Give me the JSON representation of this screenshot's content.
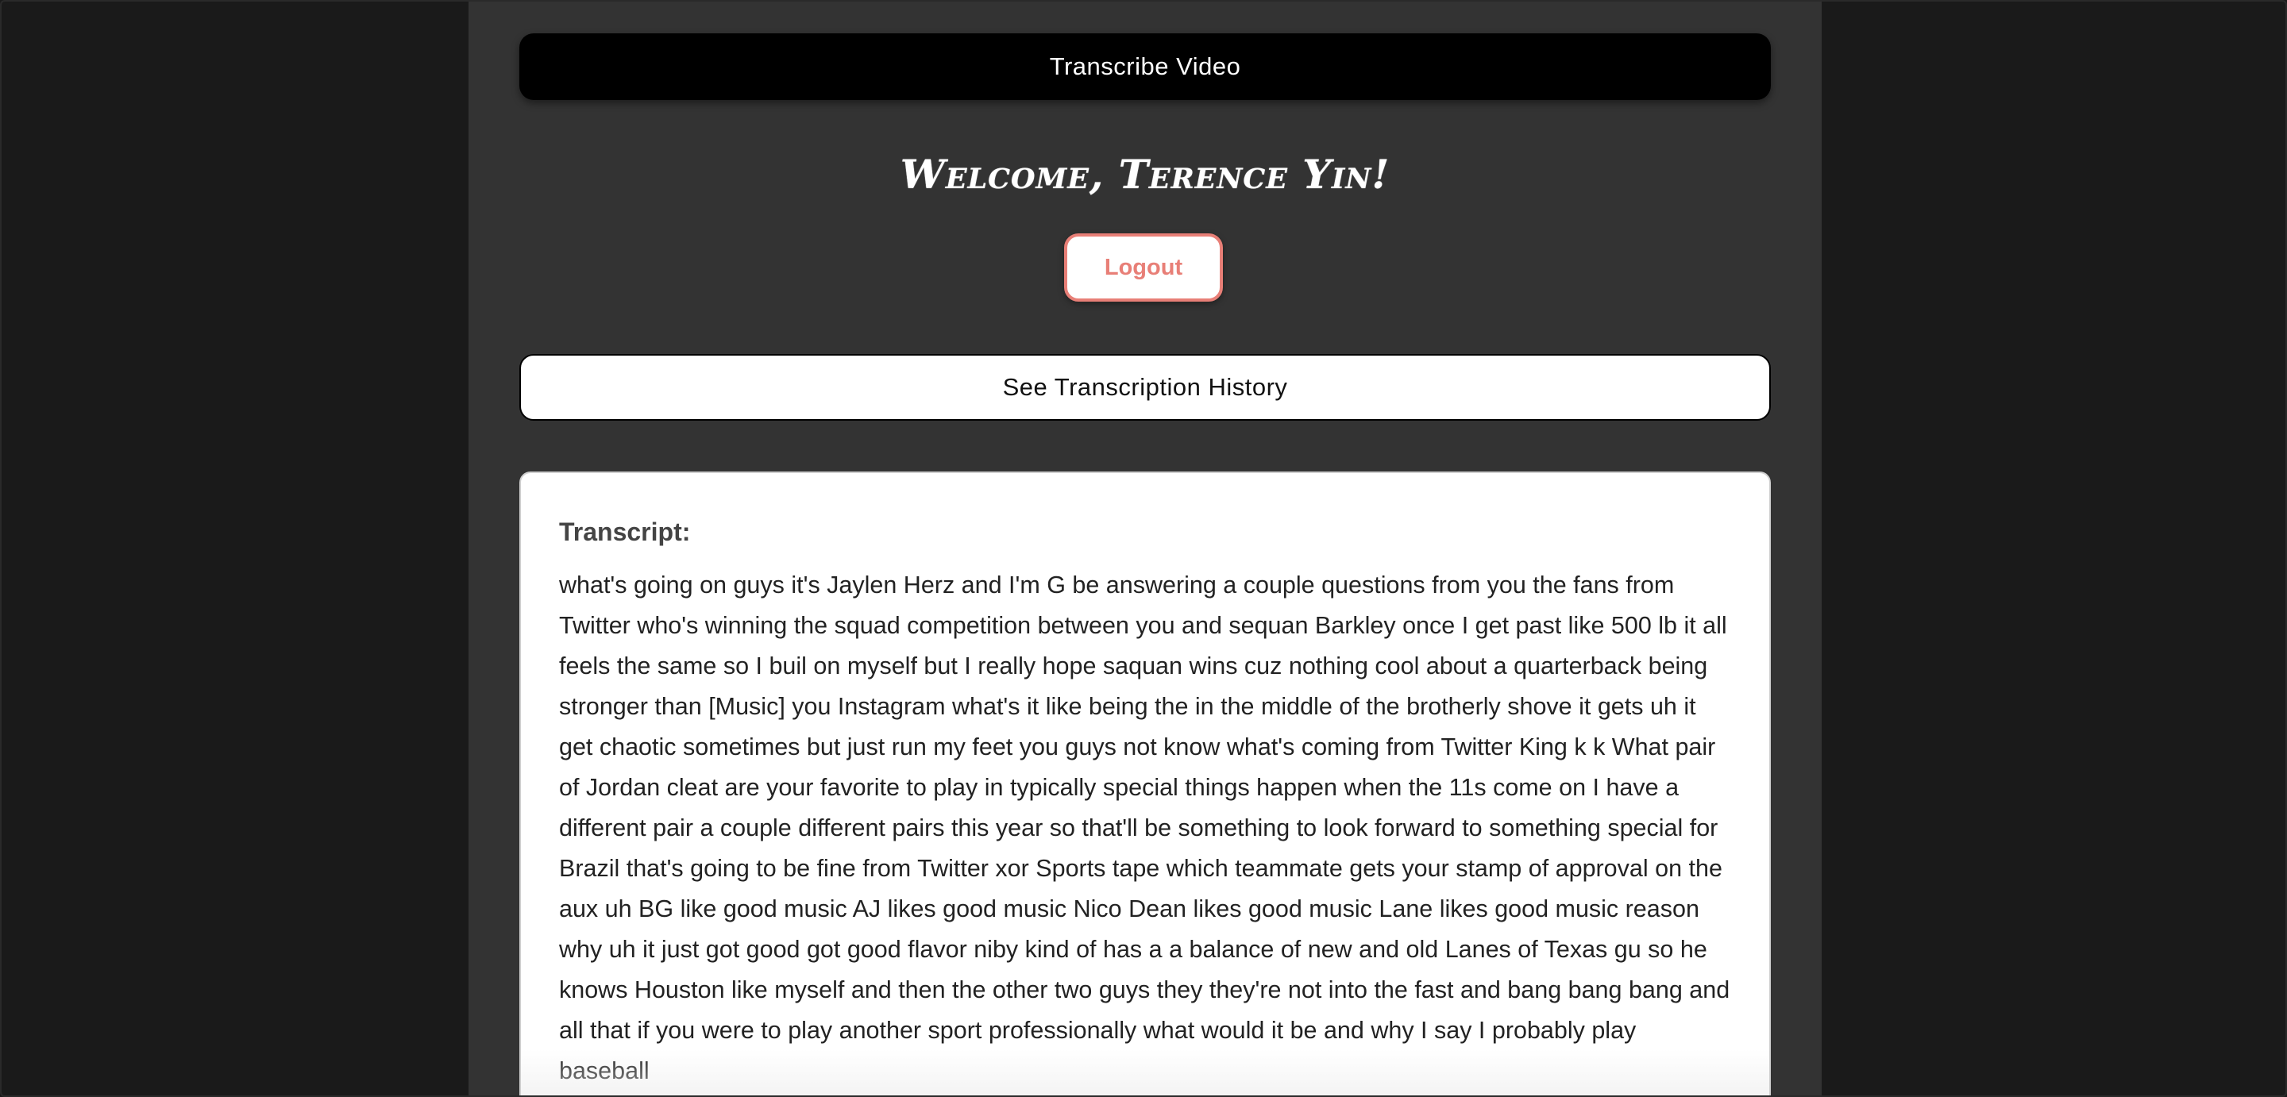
{
  "actions": {
    "transcribe_label": "Transcribe Video",
    "logout_label": "Logout",
    "history_label": "See Transcription History"
  },
  "header": {
    "welcome": "Welcome, Terence Yin!"
  },
  "transcript": {
    "heading": "Transcript:",
    "text": "what's going on guys it's Jaylen Herz and I'm G be answering a couple questions from you the fans from Twitter who's winning the squad competition between you and sequan Barkley once I get past like 500 lb it all feels the same so I buil on myself but I really hope saquan wins cuz nothing cool about a quarterback being stronger than [Music] you Instagram what's it like being the in the middle of the brotherly shove it gets uh it get chaotic sometimes but just run my feet you guys not know what's coming from Twitter King k k What pair of Jordan cleat are your favorite to play in typically special things happen when the 11s come on I have a different pair a couple different pairs this year so that'll be something to look forward to something special for Brazil that's going to be fine from Twitter xor Sports tape which teammate gets your stamp of approval on the aux uh BG like good music AJ likes good music Nico Dean likes good music Lane likes good music reason why uh it just got good got good flavor niby kind of has a a balance of new and old Lanes of Texas gu so he knows Houston like myself and then the other two guys they they're not into the fast and bang bang bang and all that if you were to play another sport professionally what would it be and why I say I probably play baseball"
  }
}
